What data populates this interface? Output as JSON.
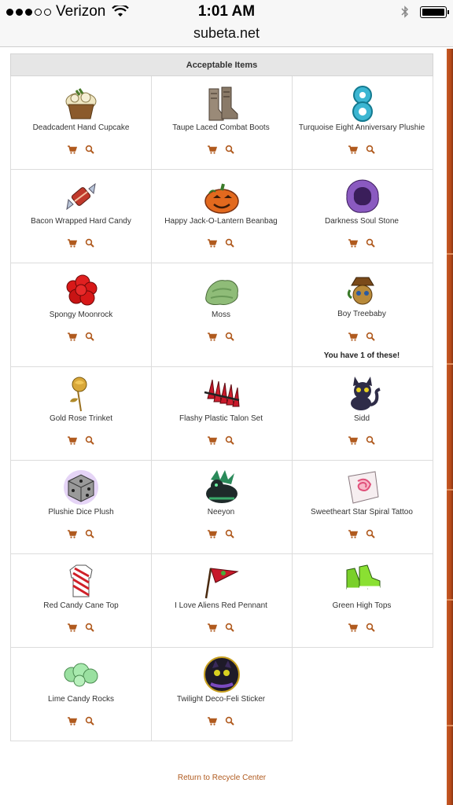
{
  "status": {
    "carrier": "Verizon",
    "time": "1:01 AM",
    "signal_icon": "signal-dots-icon",
    "wifi_icon": "wifi-icon",
    "bluetooth_icon": "bluetooth-icon",
    "battery_icon": "battery-icon"
  },
  "url": "subeta.net",
  "panel": {
    "header": "Acceptable Items"
  },
  "items": [
    {
      "name": "Deadcadent Hand Cupcake",
      "icon": "cupcake-icon"
    },
    {
      "name": "Taupe Laced Combat Boots",
      "icon": "boots-icon"
    },
    {
      "name": "Turquoise Eight Anniversary Plushie",
      "icon": "eight-plushie-icon"
    },
    {
      "name": "Bacon Wrapped Hard Candy",
      "icon": "candy-icon"
    },
    {
      "name": "Happy Jack-O-Lantern Beanbag",
      "icon": "pumpkin-icon"
    },
    {
      "name": "Darkness Soul Stone",
      "icon": "soul-stone-icon"
    },
    {
      "name": "Spongy Moonrock",
      "icon": "moonrock-icon"
    },
    {
      "name": "Moss",
      "icon": "moss-icon"
    },
    {
      "name": "Boy Treebaby",
      "icon": "treebaby-icon",
      "note": "You have 1 of these!"
    },
    {
      "name": "Gold Rose Trinket",
      "icon": "rose-icon"
    },
    {
      "name": "Flashy Plastic Talon Set",
      "icon": "talons-icon"
    },
    {
      "name": "Sidd",
      "icon": "cat-icon"
    },
    {
      "name": "Plushie Dice Plush",
      "icon": "dice-icon"
    },
    {
      "name": "Neeyon",
      "icon": "creature-icon"
    },
    {
      "name": "Sweetheart Star Spiral Tattoo",
      "icon": "tattoo-icon"
    },
    {
      "name": "Red Candy Cane Top",
      "icon": "shirt-icon"
    },
    {
      "name": "I Love Aliens Red Pennant",
      "icon": "pennant-icon"
    },
    {
      "name": "Green High Tops",
      "icon": "sneakers-icon"
    },
    {
      "name": "Lime Candy Rocks",
      "icon": "candy-rocks-icon"
    },
    {
      "name": "Twilight Deco-Feli Sticker",
      "icon": "sticker-icon"
    }
  ],
  "actions": {
    "shop_icon": "cart-icon",
    "search_icon": "search-icon"
  },
  "footer": {
    "link": "Return to Recycle Center"
  },
  "colors": {
    "accent": "#b05a1e",
    "header_bg": "#e6e6e6"
  }
}
